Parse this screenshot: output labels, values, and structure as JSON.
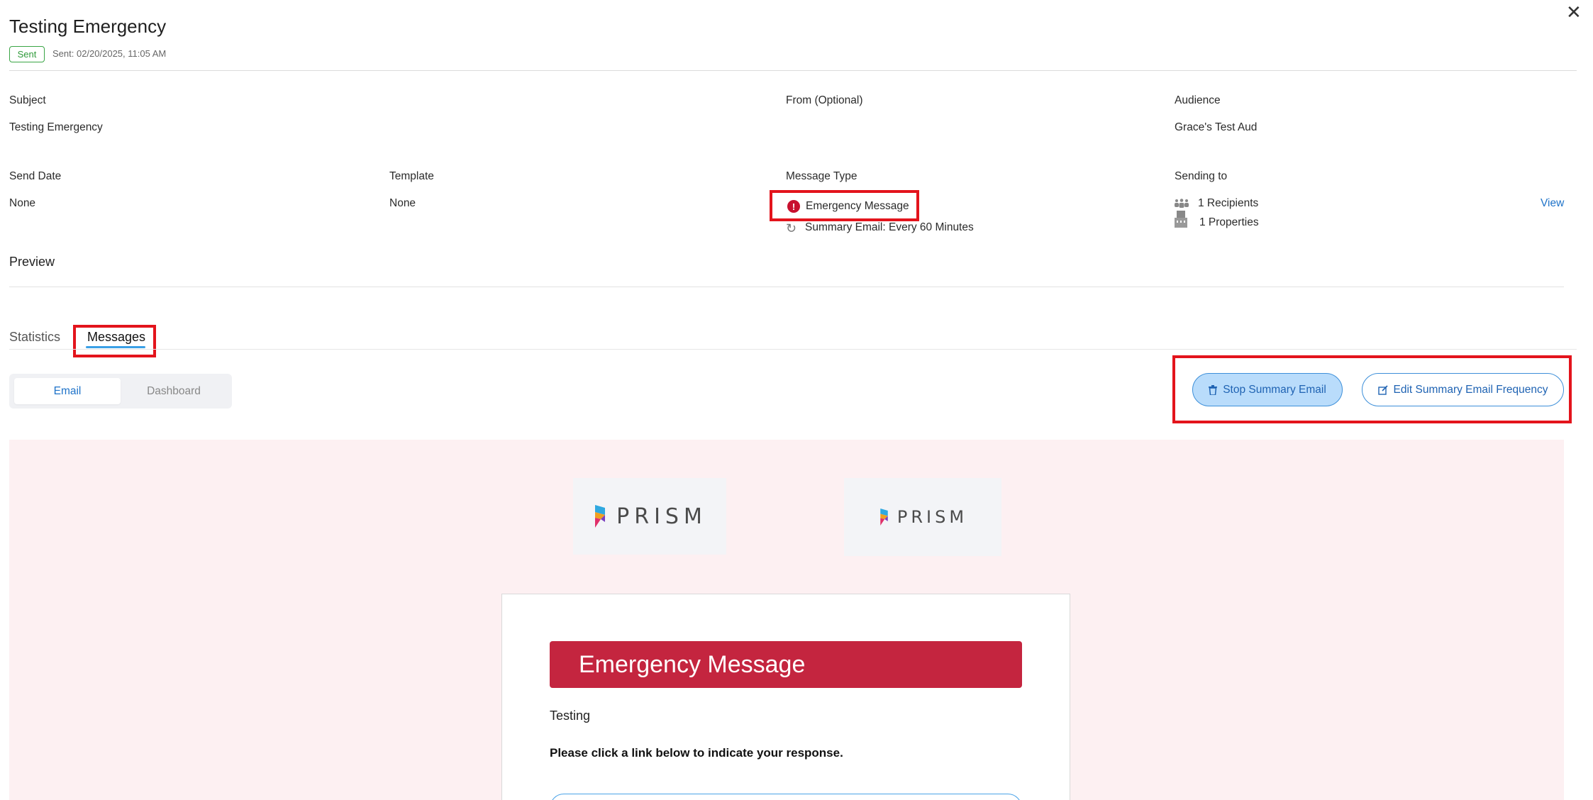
{
  "header": {
    "title": "Testing Emergency",
    "status": "Sent",
    "sent_date": "Sent: 02/20/2025, 11:05 AM"
  },
  "details": {
    "subject_label": "Subject",
    "subject_value": "Testing Emergency",
    "from_label": "From (Optional)",
    "audience_label": "Audience",
    "audience_value": "Grace's Test Aud",
    "send_date_label": "Send Date",
    "send_date_value": "None",
    "template_label": "Template",
    "template_value": "None",
    "message_type_label": "Message Type",
    "message_type_value": "Emergency Message",
    "summary_email": "Summary Email: Every 60 Minutes",
    "sending_to_label": "Sending to",
    "recipients": "1 Recipients",
    "properties": "1 Properties",
    "view_link": "View"
  },
  "preview": {
    "title": "Preview"
  },
  "tabs": [
    {
      "label": "Statistics"
    },
    {
      "label": "Messages"
    }
  ],
  "segment": {
    "email": "Email",
    "dashboard": "Dashboard"
  },
  "actions": {
    "stop_label": "Stop Summary Email",
    "edit_label": "Edit Summary Email Frequency"
  },
  "email_preview": {
    "logo_text": "PRISM",
    "banner": "Emergency Message",
    "body": "Testing",
    "instruction": "Please click a link below to indicate your response."
  },
  "colors": {
    "highlight": "#e3141c",
    "accent": "#1f73c9",
    "emergency": "#c4253f",
    "sent": "#3aa545"
  }
}
